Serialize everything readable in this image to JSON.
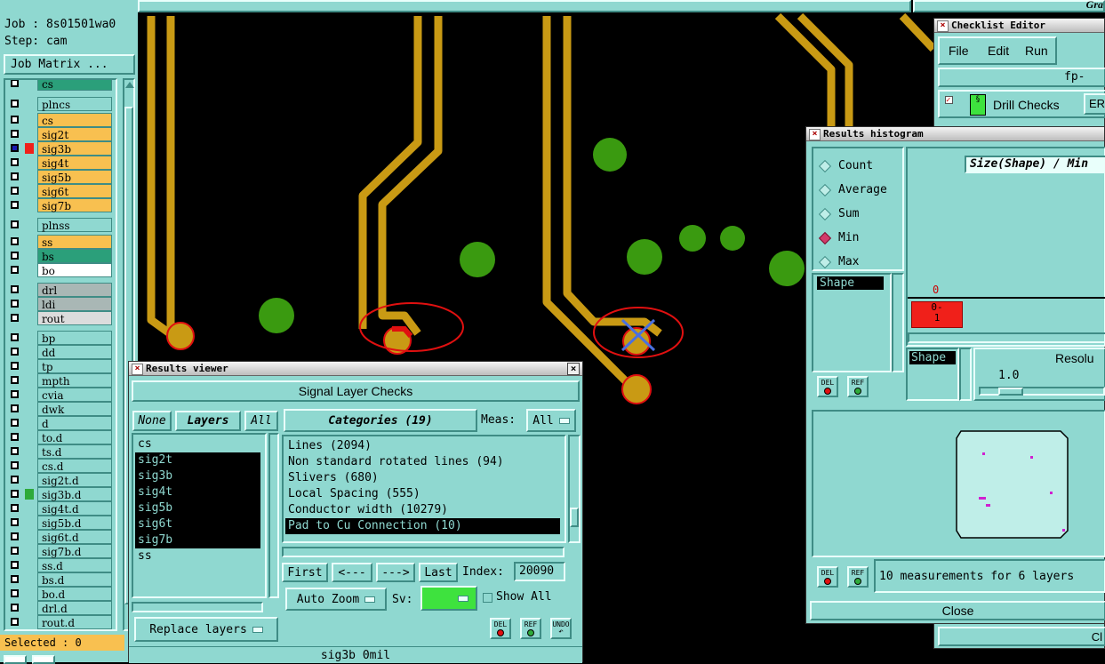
{
  "main_window": {
    "title_fragment": "Gra",
    "job": "Job : 8s01501wa0",
    "step": "Step: cam",
    "job_matrix_button": "Job Matrix ...",
    "selected": "Selected : 0"
  },
  "layers": [
    {
      "name": "cs",
      "color": "#2b9f7a",
      "editable": false,
      "selected": false,
      "partial": true
    },
    {
      "name": "plncs",
      "color": "#8fd8d0",
      "editable": false,
      "selected": false
    },
    {
      "name": "cs",
      "color": "#f8c050",
      "editable": false,
      "selected": false
    },
    {
      "name": "sig2t",
      "color": "#f8c050",
      "editable": true,
      "selected": false
    },
    {
      "name": "sig3b",
      "color": "#f8c050",
      "editable": true,
      "selected": true
    },
    {
      "name": "sig4t",
      "color": "#f8c050",
      "editable": true,
      "selected": false
    },
    {
      "name": "sig5b",
      "color": "#f8c050",
      "editable": true,
      "selected": false
    },
    {
      "name": "sig6t",
      "color": "#f8c050",
      "editable": true,
      "selected": false
    },
    {
      "name": "sig7b",
      "color": "#f8c050",
      "editable": true,
      "selected": false
    },
    {
      "name": "plnss",
      "color": "#8fd8d0",
      "editable": false,
      "selected": false
    },
    {
      "name": "ss",
      "color": "#f8c050",
      "editable": true,
      "selected": false
    },
    {
      "name": "bs",
      "color": "#2b9f7a",
      "editable": false,
      "selected": false
    },
    {
      "name": "bo",
      "color": "#ffffff",
      "editable": true,
      "selected": false
    },
    {
      "name": "drl",
      "color": "#a9b7b5",
      "editable": false,
      "selected": false
    },
    {
      "name": "ldi",
      "color": "#a9b7b5",
      "editable": false,
      "selected": false
    },
    {
      "name": "rout",
      "color": "#dcdcdc",
      "editable": false,
      "selected": false
    },
    {
      "name": "bp",
      "color": "#8fd8d0",
      "editable": false,
      "selected": false
    },
    {
      "name": "dd",
      "color": "#8fd8d0",
      "editable": false,
      "selected": false
    },
    {
      "name": "tp",
      "color": "#8fd8d0",
      "editable": false,
      "selected": false
    },
    {
      "name": "mpth",
      "color": "#8fd8d0",
      "editable": false,
      "selected": false
    },
    {
      "name": "cvia",
      "color": "#8fd8d0",
      "editable": false,
      "selected": false
    },
    {
      "name": "dwk",
      "color": "#8fd8d0",
      "editable": false,
      "selected": false
    },
    {
      "name": "d",
      "color": "#8fd8d0",
      "editable": false,
      "selected": false
    },
    {
      "name": "to.d",
      "color": "#8fd8d0",
      "editable": true,
      "selected": false
    },
    {
      "name": "ts.d",
      "color": "#8fd8d0",
      "editable": false,
      "selected": false
    },
    {
      "name": "cs.d",
      "color": "#8fd8d0",
      "editable": false,
      "selected": false
    },
    {
      "name": "sig2t.d",
      "color": "#8fd8d0",
      "editable": true,
      "selected": false
    },
    {
      "name": "sig3b.d",
      "color": "#8fd8d0",
      "editable": true,
      "selected": false,
      "marker": "#2eaa3a"
    },
    {
      "name": "sig4t.d",
      "color": "#8fd8d0",
      "editable": true,
      "selected": false
    },
    {
      "name": "sig5b.d",
      "color": "#8fd8d0",
      "editable": true,
      "selected": false
    },
    {
      "name": "sig6t.d",
      "color": "#8fd8d0",
      "editable": true,
      "selected": false
    },
    {
      "name": "sig7b.d",
      "color": "#8fd8d0",
      "editable": true,
      "selected": false
    },
    {
      "name": "ss.d",
      "color": "#8fd8d0",
      "editable": true,
      "selected": false
    },
    {
      "name": "bs.d",
      "color": "#8fd8d0",
      "editable": false,
      "selected": false
    },
    {
      "name": "bo.d",
      "color": "#8fd8d0",
      "editable": true,
      "selected": false
    },
    {
      "name": "drl.d",
      "color": "#8fd8d0",
      "editable": false,
      "selected": false
    },
    {
      "name": "rout.d",
      "color": "#8fd8d0",
      "editable": false,
      "selected": false
    }
  ],
  "results_viewer": {
    "title": "Results viewer",
    "heading": "Signal Layer Checks",
    "none_btn": "None",
    "layers_tab": "Layers",
    "all_btn": "All",
    "layer_list": [
      {
        "name": "cs",
        "sel": false
      },
      {
        "name": "sig2t",
        "sel": true
      },
      {
        "name": "sig3b",
        "sel": true
      },
      {
        "name": "sig4t",
        "sel": true
      },
      {
        "name": "sig5b",
        "sel": true
      },
      {
        "name": "sig6t",
        "sel": true
      },
      {
        "name": "sig7b",
        "sel": true
      },
      {
        "name": "ss",
        "sel": false
      }
    ],
    "categories_label": "Categories (19)",
    "meas_label": "Meas:",
    "meas_value": "All",
    "categories": [
      {
        "text": "Lines (2094)",
        "sel": false
      },
      {
        "text": "Non standard rotated lines (94)",
        "sel": false
      },
      {
        "text": "Slivers (680)",
        "sel": false
      },
      {
        "text": "Local Spacing (555)",
        "sel": false
      },
      {
        "text": "Conductor width (10279)",
        "sel": false
      },
      {
        "text": "Pad to Cu Connection (10)",
        "sel": true
      }
    ],
    "first_btn": "First",
    "prev_btn": "<---",
    "next_btn": "--->",
    "last_btn": "Last",
    "index_label": "Index:",
    "index_value": "20090",
    "auto_zoom": "Auto Zoom",
    "sv_label": "Sv:",
    "show_all": "Show All",
    "replace_layers": "Replace layers",
    "del": "DEL",
    "ref": "REF",
    "undo": "UNDO",
    "status": "sig3b 0mil"
  },
  "checklist_editor": {
    "title": "Checklist Editor",
    "menu": [
      "File",
      "Edit",
      "Run"
    ],
    "fp_label": "fp-",
    "drill_checks": "Drill Checks",
    "er_label": "ER",
    "close_fragment": "Cl"
  },
  "histogram": {
    "title": "Results histogram",
    "options": [
      {
        "label": "Count",
        "on": false
      },
      {
        "label": "Average",
        "on": false
      },
      {
        "label": "Sum",
        "on": false
      },
      {
        "label": "Min",
        "on": true
      },
      {
        "label": "Max",
        "on": false
      }
    ],
    "size_label": "Size(Shape) / Min",
    "list_item": "Shape",
    "bar_count": "0",
    "bar_label": "0-\n1",
    "bar_color": "#f0201a",
    "shape_label": "Shape",
    "resolution_label": "Resolu",
    "resolution_value": "1.0",
    "del": "DEL",
    "ref": "REF",
    "measurements": "10 measurements for 6 layers",
    "close": "Close"
  },
  "colors": {
    "panel": "#8fd8d0",
    "trace": "#c99a14",
    "pad": "#3a9a10",
    "highlight": "#e01010",
    "sv_color": "#3ee23e"
  }
}
